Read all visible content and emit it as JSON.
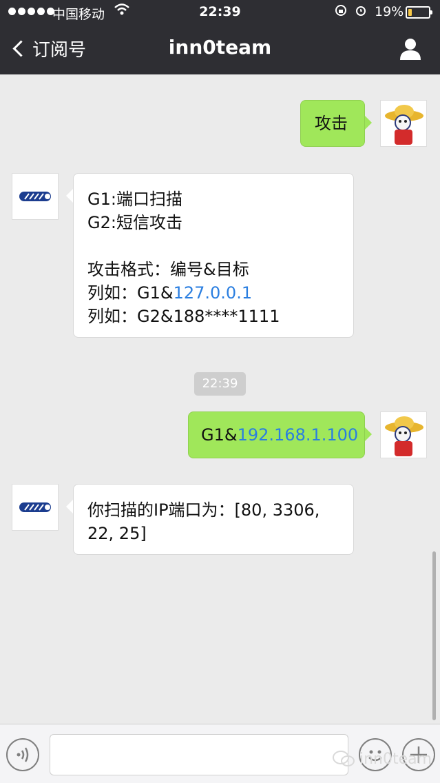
{
  "status_bar": {
    "carrier": "中国移动",
    "time": "22:39",
    "battery": "19%",
    "battery_level": 0.19
  },
  "nav": {
    "back_label": "订阅号",
    "title": "inn0team"
  },
  "messages": {
    "m1": {
      "text": "攻击"
    },
    "m2": {
      "line1": "G1:端口扫描",
      "line2": "G2:短信攻击",
      "line3": "攻击格式：编号&目标",
      "line4_prefix": "列如：G1&",
      "line4_link": "127.0.0.1",
      "line5": "列如：G2&188****1111"
    },
    "timestamp": "22:39",
    "m3": {
      "prefix": "G1&",
      "link": "192.168.1.100"
    },
    "m4": {
      "text": "你扫描的IP端口为：[80, 3306, 22, 25]"
    }
  },
  "watermark": "inn0team",
  "colors": {
    "nav_bg": "#2e2e33",
    "bubble_green": "#a0e75a",
    "link_blue": "#2a7ee0",
    "chat_bg": "#ebebeb"
  }
}
